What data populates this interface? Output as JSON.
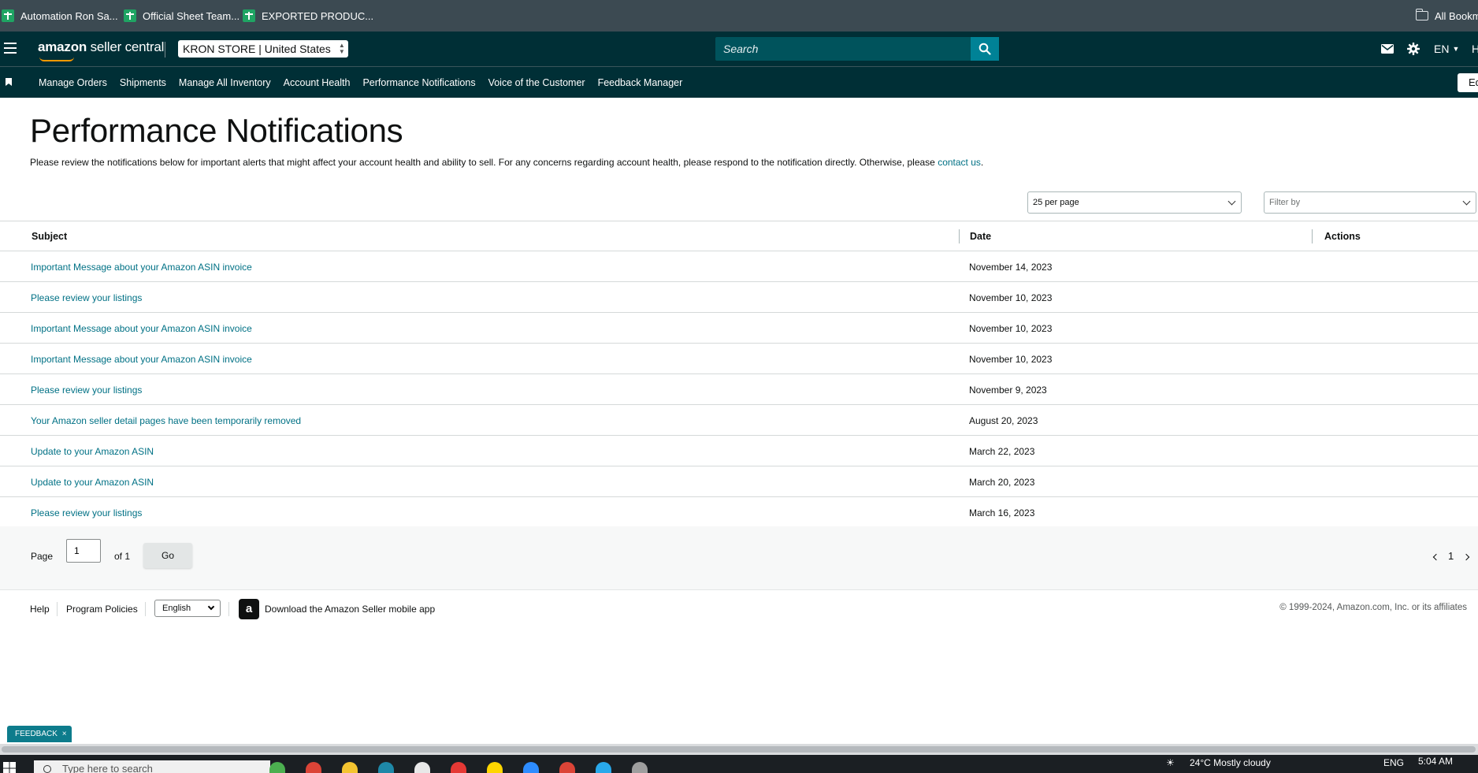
{
  "bookmarks": {
    "items": [
      {
        "label": "Automation Ron Sa..."
      },
      {
        "label": "Official Sheet Team..."
      },
      {
        "label": "EXPORTED PRODUC..."
      }
    ],
    "all_bookmarks": "All Bookma"
  },
  "topbar": {
    "logo_brand": "amazon",
    "logo_product": "seller central",
    "store_name": "KRON STORE",
    "store_marketplace": "| United States",
    "search_placeholder": "Search",
    "language": "EN",
    "help_initial": "H"
  },
  "nav": {
    "items": [
      "Manage Orders",
      "Shipments",
      "Manage All Inventory",
      "Account Health",
      "Performance Notifications",
      "Voice of the Customer",
      "Feedback Manager"
    ],
    "edit_label": "Ed"
  },
  "page": {
    "title": "Performance Notifications",
    "description": "Please review the notifications below for important alerts that might affect your account health and ability to sell. For any concerns regarding account health, please respond to the notification directly. Otherwise, please ",
    "contact_link": "contact us",
    "description_end": "."
  },
  "filters": {
    "per_page": "25 per page",
    "filter_placeholder": "Filter by"
  },
  "table": {
    "headers": {
      "subject": "Subject",
      "date": "Date",
      "actions": "Actions"
    },
    "rows": [
      {
        "subject": "Important Message about your Amazon ASIN invoice",
        "date": "November 14, 2023"
      },
      {
        "subject": "Please review your listings",
        "date": "November 10, 2023"
      },
      {
        "subject": "Important Message about your Amazon ASIN invoice",
        "date": "November 10, 2023"
      },
      {
        "subject": "Important Message about your Amazon ASIN invoice",
        "date": "November 10, 2023"
      },
      {
        "subject": "Please review your listings",
        "date": "November 9, 2023"
      },
      {
        "subject": "Your Amazon seller detail pages have been temporarily removed",
        "date": "August 20, 2023"
      },
      {
        "subject": "Update to your Amazon ASIN",
        "date": "March 22, 2023"
      },
      {
        "subject": "Update to your Amazon ASIN",
        "date": "March 20, 2023"
      },
      {
        "subject": "Please review your listings",
        "date": "March 16, 2023"
      }
    ]
  },
  "pager": {
    "page_label": "Page",
    "page_value": "1",
    "of_label": "of 1",
    "go_label": "Go",
    "current_page": "1"
  },
  "footer": {
    "help": "Help",
    "policies": "Program Policies",
    "language": "English",
    "app_icon_letter": "a",
    "app_download": "Download the Amazon Seller mobile app",
    "copyright": "© 1999-2024, Amazon.com, Inc. or its affiliates"
  },
  "feedback": {
    "label": "FEEDBACK",
    "close": "×"
  },
  "taskbar": {
    "search_placeholder": "Type here to search",
    "weather": "24°C  Mostly cloudy",
    "lang": "ENG",
    "time": "5:04 AM"
  },
  "colors": {
    "header_bg": "#002f36",
    "link": "#007185",
    "search_btn": "#008296",
    "feedback_bg": "#0d7c8c"
  }
}
